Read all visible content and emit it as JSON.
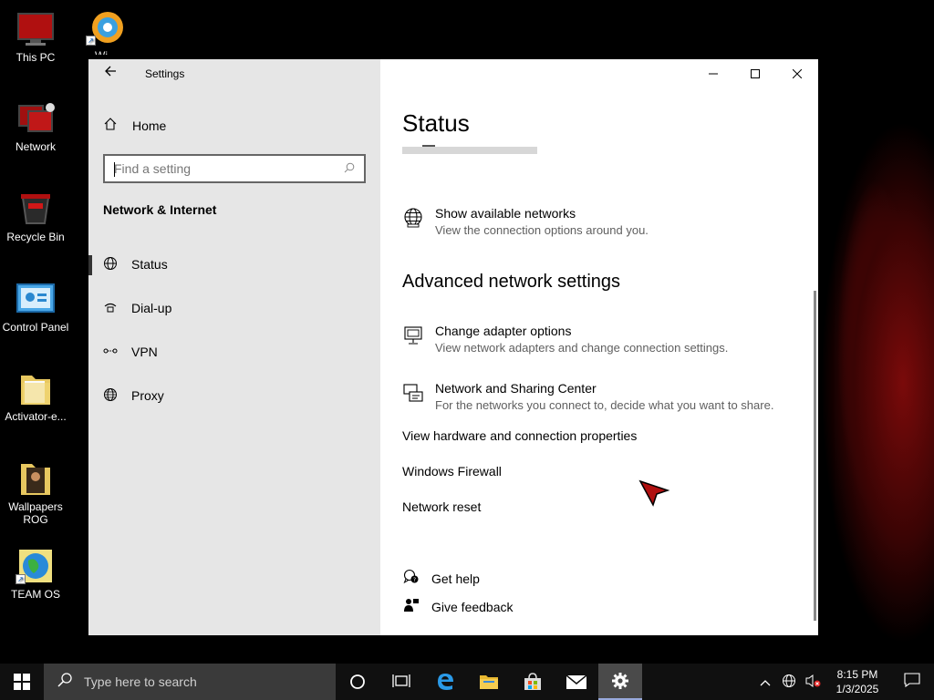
{
  "desktop": {
    "icons": [
      {
        "label": "This PC",
        "icon": "monitor-icon"
      },
      {
        "label": "Network",
        "icon": "network-icon"
      },
      {
        "label": "Recycle Bin",
        "icon": "recycle-bin-icon"
      },
      {
        "label": "Control Panel",
        "icon": "control-panel-icon"
      },
      {
        "label": "Activator-e...",
        "icon": "folder-icon"
      },
      {
        "label": "Wallpapers ROG",
        "icon": "folder-icon"
      },
      {
        "label": "TEAM OS",
        "icon": "globe-icon"
      }
    ],
    "top_shortcut_label": "Wi..."
  },
  "window": {
    "title": "Settings",
    "sidebar": {
      "home": "Home",
      "search_placeholder": "Find a setting",
      "section": "Network & Internet",
      "items": [
        {
          "label": "Status",
          "icon": "globe-status-icon",
          "active": true
        },
        {
          "label": "Dial-up",
          "icon": "dialup-icon",
          "active": false
        },
        {
          "label": "VPN",
          "icon": "vpn-icon",
          "active": false
        },
        {
          "label": "Proxy",
          "icon": "globe-icon",
          "active": false
        }
      ]
    },
    "content": {
      "title": "Status",
      "show_networks": {
        "title": "Show available networks",
        "desc": "View the connection options around you."
      },
      "advanced_heading": "Advanced network settings",
      "adapter": {
        "title": "Change adapter options",
        "desc": "View network adapters and change connection settings."
      },
      "sharing": {
        "title": "Network and Sharing Center",
        "desc": "For the networks you connect to, decide what you want to share."
      },
      "links": [
        "View hardware and connection properties",
        "Windows Firewall",
        "Network reset"
      ],
      "help": {
        "get_help": "Get help",
        "give_feedback": "Give feedback"
      }
    }
  },
  "taskbar": {
    "search_placeholder": "Type here to search",
    "time": "8:15 PM",
    "date": "1/3/2025"
  },
  "colors": {
    "sidebar_bg": "#e6e6e6",
    "taskbar_bg": "#101010",
    "accent": "#0078d7"
  }
}
